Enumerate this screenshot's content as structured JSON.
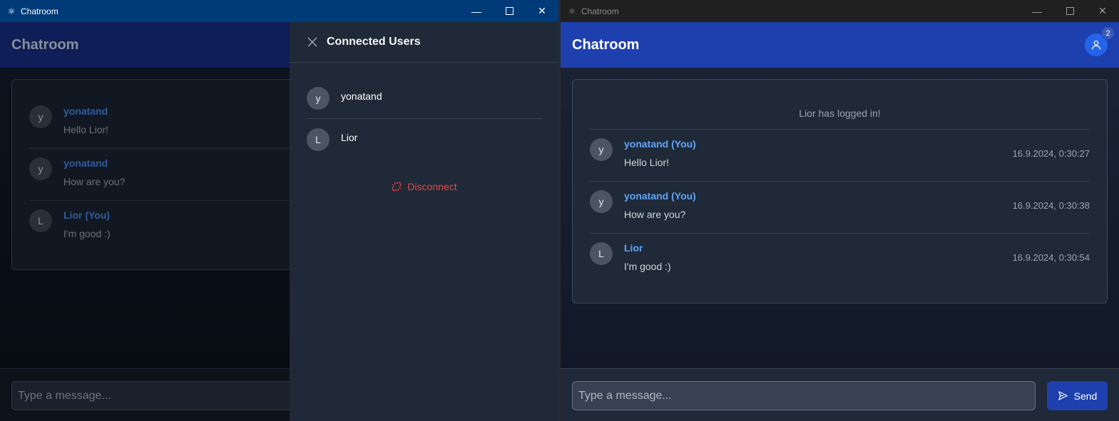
{
  "left_window": {
    "titlebar": {
      "title": "Chatroom",
      "min": "—",
      "max": "☐",
      "close": "✕"
    },
    "header": {
      "title": "Chatroom"
    },
    "messages": [
      {
        "avatar": "y",
        "author": "yonatand",
        "text": "Hello Lior!"
      },
      {
        "avatar": "y",
        "author": "yonatand",
        "text": "How are you?"
      },
      {
        "avatar": "L",
        "author": "Lior (You)",
        "text": "I'm good :)"
      }
    ],
    "input_placeholder": "Type a message...",
    "drawer": {
      "title": "Connected Users",
      "users": [
        {
          "avatar": "y",
          "name": "yonatand"
        },
        {
          "avatar": "L",
          "name": "Lior"
        }
      ],
      "disconnect_label": "Disconnect"
    }
  },
  "right_window": {
    "titlebar": {
      "title": "Chatroom",
      "min": "—",
      "max": "☐",
      "close": "✕"
    },
    "header": {
      "title": "Chatroom",
      "users_count": "2"
    },
    "system_message": "Lior has logged in!",
    "messages": [
      {
        "avatar": "y",
        "author": "yonatand (You)",
        "text": "Hello Lior!",
        "time": "16.9.2024, 0:30:27"
      },
      {
        "avatar": "y",
        "author": "yonatand (You)",
        "text": "How are you?",
        "time": "16.9.2024, 0:30:38"
      },
      {
        "avatar": "L",
        "author": "Lior",
        "text": "I'm good :)",
        "time": "16.9.2024, 0:30:54"
      }
    ],
    "input_placeholder": "Type a message...",
    "send_label": "Send"
  },
  "colors": {
    "header_blue": "#1e40af",
    "accent_blue": "#60a5fa",
    "panel": "#1f2937",
    "danger": "#ef4444"
  },
  "icons": {
    "app": "electron-icon",
    "users": "user-icon",
    "send": "send-icon",
    "disconnect": "unlink-icon",
    "close": "close-icon"
  }
}
